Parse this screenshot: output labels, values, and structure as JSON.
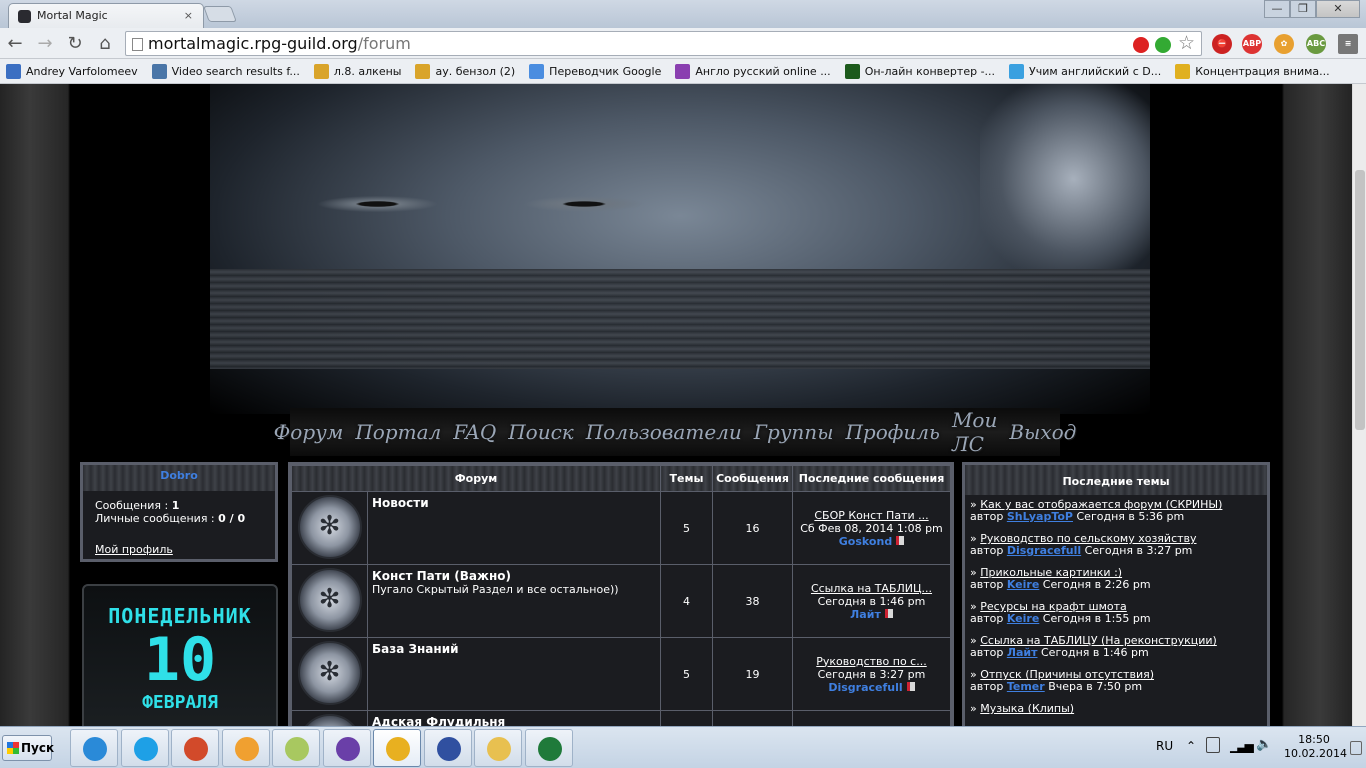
{
  "browser": {
    "tab_title": "Mortal Magic",
    "tab_close": "×",
    "url_host": "mortalmagic.rpg-guild.org",
    "url_path": "/forum",
    "window_buttons": [
      "—",
      "❐",
      "✕"
    ],
    "nav_icons": [
      "back-arrow-icon",
      "forward-arrow-icon",
      "reload-icon",
      "home-icon"
    ],
    "extensions": [
      "PRO",
      "✔",
      "⛔",
      "ABP",
      "✿",
      "ABC",
      "≡"
    ]
  },
  "bookmarks": [
    {
      "label": "Andrey Varfolomeev",
      "color": "#3b6fc2"
    },
    {
      "label": "Video search results f...",
      "color": "#4a76a8"
    },
    {
      "label": "л.8. алкены",
      "color": "#d9a42a"
    },
    {
      "label": "ау. бензол (2)",
      "color": "#d9a42a"
    },
    {
      "label": "Переводчик Google",
      "color": "#4a8de0"
    },
    {
      "label": "Англо русский online ...",
      "color": "#8a3fb0"
    },
    {
      "label": "Он-лайн конвертер -...",
      "color": "#1c5a1c"
    },
    {
      "label": "Учим английский с D...",
      "color": "#3aa0e0"
    },
    {
      "label": "Концентрация внима...",
      "color": "#e0b020"
    }
  ],
  "menu": [
    "Форум",
    "Портал",
    "FAQ",
    "Поиск",
    "Пользователи",
    "Группы",
    "Профиль",
    "Мои ЛС",
    "Выход"
  ],
  "userbox": {
    "username": "Dobro",
    "messages_label": "Сообщения :",
    "messages_value": "1",
    "pm_label": "Личные сообщения :",
    "pm_value": "0 / 0",
    "profile_link": "Мой профиль"
  },
  "clock_widget": {
    "day": "ПОНЕДЕЛЬНИК",
    "date": "10",
    "month": "ФЕВРАЛЯ"
  },
  "forum_table": {
    "headers": [
      "Форум",
      "Темы",
      "Сообщения",
      "Последние сообщения"
    ],
    "rows": [
      {
        "title": "Новости",
        "desc": "",
        "topics": "5",
        "posts": "16",
        "last_title": "СБОР Конст Пати ...",
        "last_date": "Сб Фев 08, 2014 1:08 pm",
        "last_author": "Goskond"
      },
      {
        "title": "Конст Пати (Важно)",
        "desc": "Пугало Скрытый Раздел и все остальное))",
        "topics": "4",
        "posts": "38",
        "last_title": "Ссылка на ТАБЛИЦ...",
        "last_date": "Сегодня в 1:46 pm",
        "last_author": "Лайт"
      },
      {
        "title": "База Знаний",
        "desc": "",
        "topics": "5",
        "posts": "19",
        "last_title": "Руководство по с...",
        "last_date": "Сегодня в 3:27 pm",
        "last_author": "Disgracefull"
      },
      {
        "title": "Адская Флудильня",
        "desc": "",
        "topics": "",
        "posts": "",
        "last_title": "",
        "last_date": "",
        "last_author": ""
      }
    ]
  },
  "latest": {
    "title": "Последние темы",
    "by_label": "автор",
    "items": [
      {
        "topic": "Как у вас отображается форум (СКРИНЫ)",
        "author": "ShLyapToP",
        "time": "Сегодня в 5:36 pm"
      },
      {
        "topic": "Руководство по сельскому хозяйству ",
        "author": "Disgracefull",
        "time": "Сегодня в 3:27 pm"
      },
      {
        "topic": "Прикольные картинки :)",
        "author": "Keire",
        "time": "Сегодня в 2:26 pm"
      },
      {
        "topic": "Ресурсы на крафт шмота",
        "author": "Keire",
        "time": "Сегодня в 1:55 pm"
      },
      {
        "topic": "Ссылка на ТАБЛИЦУ (На реконструкции)",
        "author": "Лайт",
        "time": "Сегодня в 1:46 pm"
      },
      {
        "topic": "Отпуск (Причины отсутствия)",
        "author": "Temer",
        "time": "Вчера в 7:50 pm"
      },
      {
        "topic": "Музыка (Клипы)",
        "author": "",
        "time": ""
      }
    ]
  },
  "taskbar": {
    "start_label": "Пуск",
    "lang": "RU",
    "time": "18:50",
    "date": "10.02.2014",
    "apps": [
      {
        "name": "ccleaner-icon",
        "color": "#2a8ad8"
      },
      {
        "name": "skype-icon",
        "color": "#1ea0e6"
      },
      {
        "name": "ccleaner-brush-icon",
        "color": "#d24a2a"
      },
      {
        "name": "media-player-icon",
        "color": "#f0a030"
      },
      {
        "name": "sticky-notes-icon",
        "color": "#a8c860"
      },
      {
        "name": "visual-studio-icon",
        "color": "#6a3fa8"
      },
      {
        "name": "chrome-icon",
        "color": "#e8b020"
      },
      {
        "name": "save-floppy-icon",
        "color": "#3050a0"
      },
      {
        "name": "folder-icon",
        "color": "#e8c050"
      },
      {
        "name": "excel-icon",
        "color": "#1f7a3a"
      }
    ]
  }
}
